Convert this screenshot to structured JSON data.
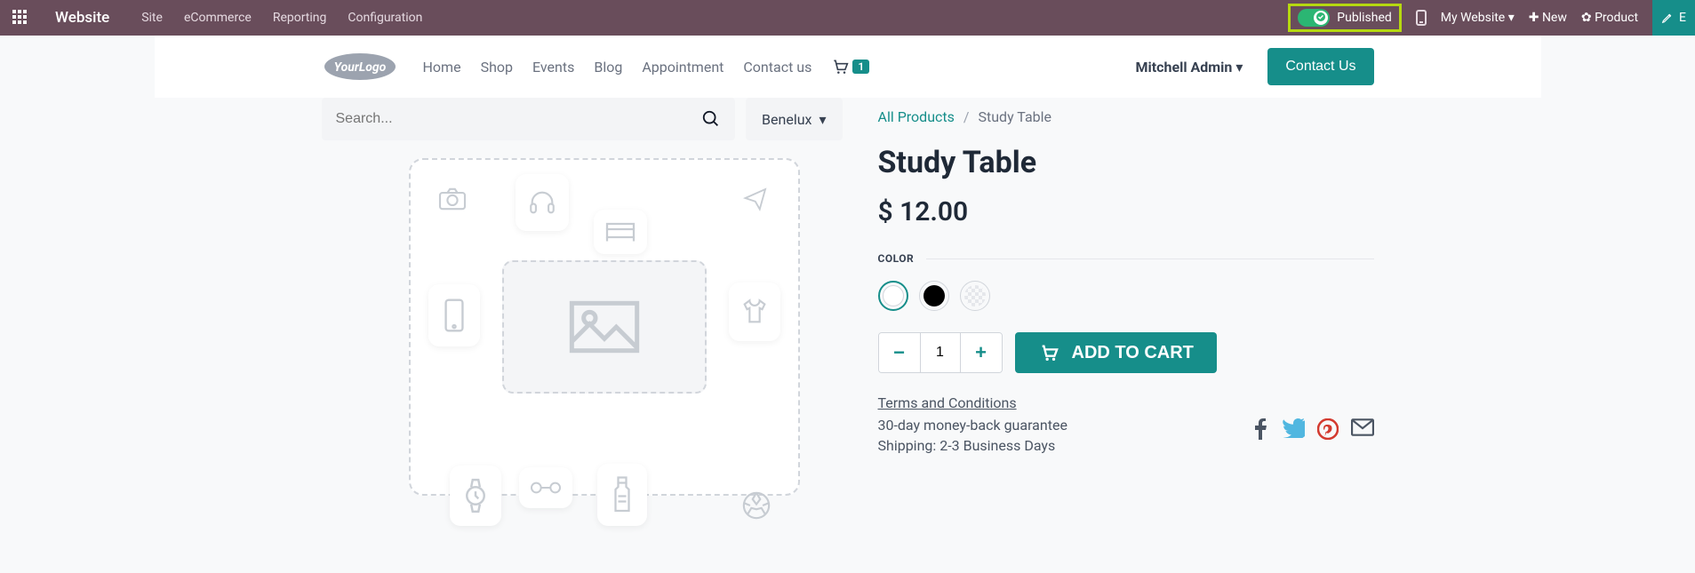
{
  "topbar": {
    "brand": "Website",
    "menu": [
      "Site",
      "eCommerce",
      "Reporting",
      "Configuration"
    ],
    "published_label": "Published",
    "my_website": "My Website",
    "new_label": "New",
    "product_label": "Product",
    "edit_label": "E"
  },
  "siteheader": {
    "logo_text": "YourLogo",
    "nav": [
      "Home",
      "Shop",
      "Events",
      "Blog",
      "Appointment",
      "Contact us"
    ],
    "cart_count": "1",
    "user": "Mitchell Admin",
    "contact_btn": "Contact Us"
  },
  "search": {
    "placeholder": "Search...",
    "location": "Benelux"
  },
  "breadcrumb": {
    "root": "All Products",
    "current": "Study Table"
  },
  "product": {
    "title": "Study Table",
    "price": "$ 12.00",
    "color_label": "COLOR",
    "qty": "1",
    "add_to_cart": "ADD TO CART",
    "terms": "Terms and Conditions",
    "guarantee": "30-day money-back guarantee",
    "shipping": "Shipping: 2-3 Business Days"
  },
  "colors": {
    "brand": "#168e8a",
    "topbar_bg": "#694d5b",
    "highlight": "#b6d810"
  }
}
